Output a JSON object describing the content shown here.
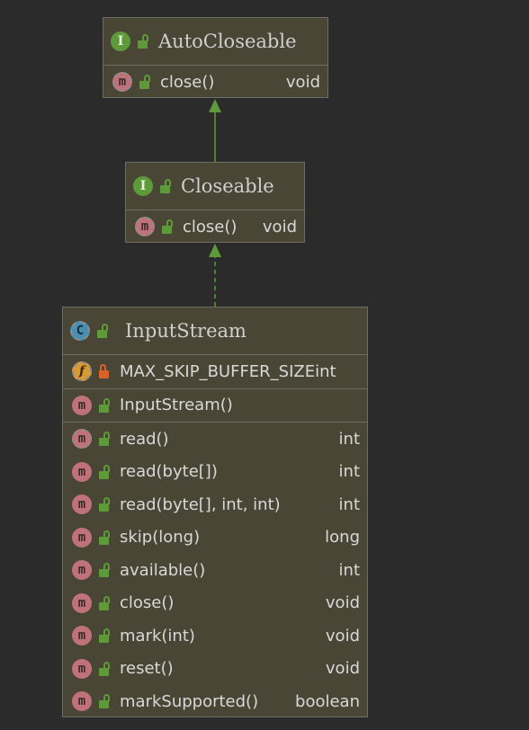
{
  "diagram": {
    "auto_closeable": {
      "kind": "I",
      "name": "AutoCloseable",
      "methods": [
        {
          "kind": "m",
          "name": "close()",
          "type": "void",
          "abstract": true
        }
      ]
    },
    "closeable": {
      "kind": "I",
      "name": "Closeable",
      "methods": [
        {
          "kind": "m",
          "name": "close()",
          "type": "void",
          "abstract": true
        }
      ]
    },
    "input_stream": {
      "kind": "C",
      "name": "InputStream",
      "fields": [
        {
          "kind": "f",
          "name": "MAX_SKIP_BUFFER_SIZE",
          "type": "int"
        }
      ],
      "constructors": [
        {
          "kind": "m",
          "name": "InputStream()"
        }
      ],
      "methods": [
        {
          "kind": "m",
          "name": "read()",
          "type": "int",
          "abstract": true
        },
        {
          "kind": "m",
          "name": "read(byte[])",
          "type": "int"
        },
        {
          "kind": "m",
          "name": "read(byte[], int, int)",
          "type": "int"
        },
        {
          "kind": "m",
          "name": "skip(long)",
          "type": "long"
        },
        {
          "kind": "m",
          "name": "available()",
          "type": "int"
        },
        {
          "kind": "m",
          "name": "close()",
          "type": "void"
        },
        {
          "kind": "m",
          "name": "mark(int)",
          "type": "void"
        },
        {
          "kind": "m",
          "name": "reset()",
          "type": "void"
        },
        {
          "kind": "m",
          "name": "markSupported()",
          "type": "boolean"
        }
      ]
    },
    "colors": {
      "background": "#2b2b2b",
      "box": "#4a4636",
      "edge": "#5e9a3a",
      "method_badge": "#c0727a",
      "class_badge": "#4a8fb0",
      "field_badge": "#d79a35",
      "interface_badge": "#5e9a3a"
    }
  }
}
